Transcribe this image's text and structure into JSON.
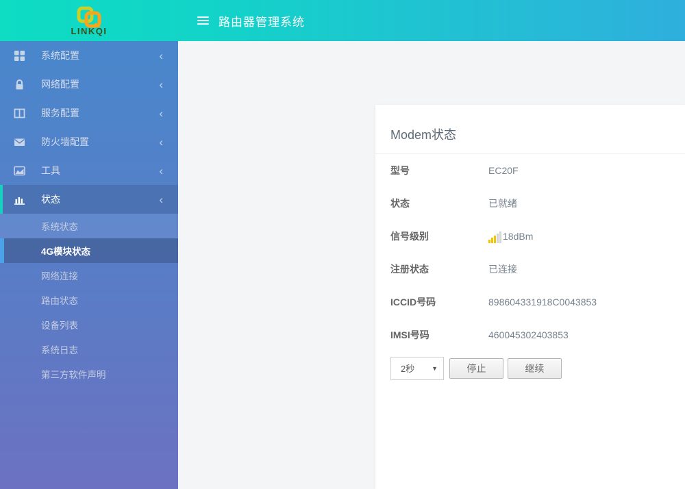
{
  "header": {
    "brand": "LINKQI",
    "title": "路由器管理系统"
  },
  "sidebar": {
    "items": [
      {
        "label": "系统配置",
        "icon": "grid-icon",
        "chevron": "‹"
      },
      {
        "label": "网络配置",
        "icon": "lock-icon",
        "chevron": "‹"
      },
      {
        "label": "服务配置",
        "icon": "columns-icon",
        "chevron": "‹"
      },
      {
        "label": "防火墙配置",
        "icon": "envelope-icon",
        "chevron": "‹"
      },
      {
        "label": "工具",
        "icon": "chart-area-icon",
        "chevron": "‹"
      },
      {
        "label": "状态",
        "icon": "bar-chart-icon",
        "chevron": "‹",
        "active": true
      }
    ],
    "subitems": [
      {
        "label": "系统状态"
      },
      {
        "label": "4G模块状态",
        "active": true
      },
      {
        "label": "网络连接"
      },
      {
        "label": "路由状态"
      },
      {
        "label": "设备列表"
      },
      {
        "label": "系统日志"
      },
      {
        "label": "第三方软件声明"
      }
    ]
  },
  "main": {
    "card_title": "Modem状态",
    "fields": [
      {
        "label": "型号",
        "value": "EC20F"
      },
      {
        "label": "状态",
        "value": "已就绪"
      },
      {
        "label": "信号级别",
        "value": "18dBm",
        "icon": "signal-bars-icon",
        "signal_bars_filled": 3,
        "signal_bars_total": 5
      },
      {
        "label": "注册状态",
        "value": "已连接"
      },
      {
        "label": "ICCID号码",
        "value": "898604331918C0043853"
      },
      {
        "label": "IMSI号码",
        "value": "460045302403853"
      }
    ],
    "controls": {
      "interval_value": "2秒",
      "stop_label": "停止",
      "continue_label": "继续"
    }
  },
  "colors": {
    "header_gradient_start": "#0edcc3",
    "header_gradient_end": "#2fafdd",
    "sidebar_gradient_top": "#4987cc",
    "sidebar_gradient_bottom": "#6c72c1",
    "active_parent_accent": "#16d0c0",
    "active_sub_accent": "#4aa3e8",
    "signal_yellow": "#f2c500",
    "signal_gray": "#d5d5d5",
    "logo_yellow": "#c9d02a",
    "logo_orange": "#f8a41c"
  }
}
